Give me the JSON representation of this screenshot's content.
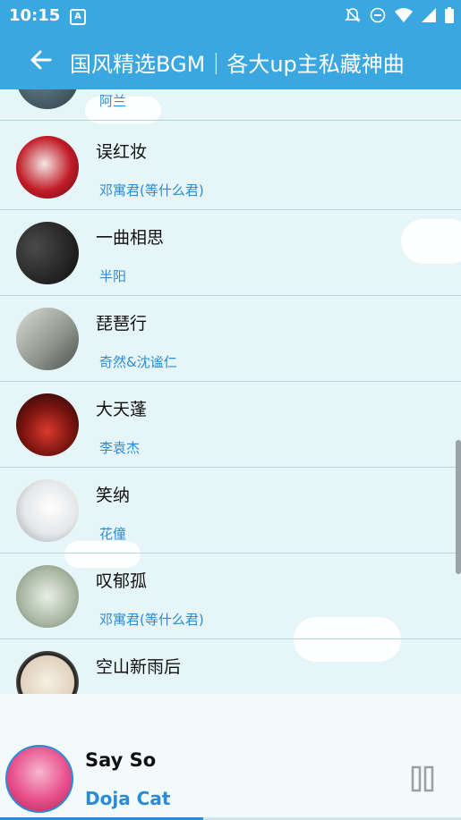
{
  "status_bar": {
    "time": "10:15",
    "notification_icon": "A",
    "icons": [
      "notifications-off-icon",
      "do-not-disturb-icon",
      "wifi-icon",
      "signal-icon",
      "battery-icon"
    ]
  },
  "app_bar": {
    "title": "国风精选BGM｜各大up主私藏神曲",
    "back_icon": "arrow-left-icon"
  },
  "songs": [
    {
      "title": "",
      "artist": "阿兰"
    },
    {
      "title": "误红妆",
      "artist": "邓寓君(等什么君)"
    },
    {
      "title": "一曲相思",
      "artist": "半阳"
    },
    {
      "title": "琵琶行",
      "artist": "奇然&沈谧仁"
    },
    {
      "title": "大天蓬",
      "artist": "李袁杰"
    },
    {
      "title": "笑纳",
      "artist": "花僮"
    },
    {
      "title": "叹郁孤",
      "artist": "邓寓君(等什么君)"
    },
    {
      "title": "空山新雨后",
      "artist": ""
    }
  ],
  "now_playing": {
    "title": "Say So",
    "artist": "Doja Cat",
    "progress": 0.44,
    "pause_icon": "pause-icon"
  },
  "colors": {
    "primary": "#3aa7e0",
    "accent": "#2b8bd6",
    "list_background": "#e6f5f7"
  }
}
